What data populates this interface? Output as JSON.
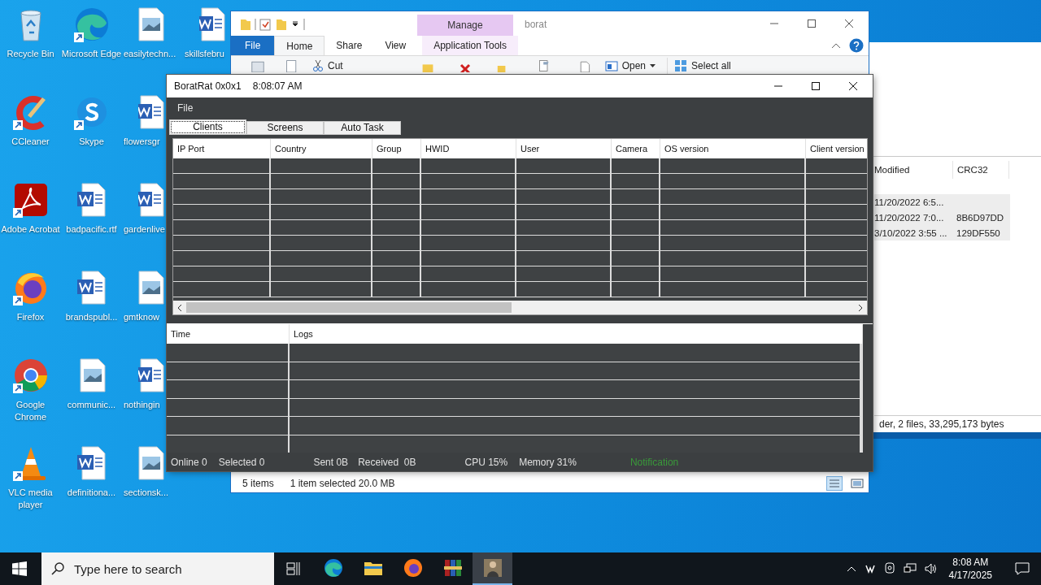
{
  "desktop_icons": [
    {
      "label": "Recycle Bin",
      "kind": "recycle",
      "shortcut": false
    },
    {
      "label": "CCleaner",
      "kind": "ccleaner",
      "shortcut": true
    },
    {
      "label": "Adobe Acrobat",
      "kind": "acrobat",
      "shortcut": true
    },
    {
      "label": "Firefox",
      "kind": "firefox",
      "shortcut": true
    },
    {
      "label": "Google Chrome",
      "kind": "chrome",
      "shortcut": true
    },
    {
      "label": "VLC media player",
      "kind": "vlc",
      "shortcut": true
    },
    {
      "label": "Microsoft Edge",
      "kind": "edge",
      "shortcut": true
    },
    {
      "label": "Skype",
      "kind": "skype",
      "shortcut": true
    },
    {
      "label": "badpacific.rtf",
      "kind": "word",
      "shortcut": false
    },
    {
      "label": "brandspubl...",
      "kind": "word",
      "shortcut": false
    },
    {
      "label": "communic...",
      "kind": "image",
      "shortcut": false
    },
    {
      "label": "definitiona...",
      "kind": "word",
      "shortcut": false
    },
    {
      "label": "easilytechn...",
      "kind": "image",
      "shortcut": false
    },
    {
      "label": "flowersgr",
      "kind": "word",
      "shortcut": false
    },
    {
      "label": "gardenlive",
      "kind": "word",
      "shortcut": false
    },
    {
      "label": "gmtknow",
      "kind": "image",
      "shortcut": false
    },
    {
      "label": "nothingin",
      "kind": "word",
      "shortcut": false
    },
    {
      "label": "sectionsk...",
      "kind": "image",
      "shortcut": false
    },
    {
      "label": "skillsfebru",
      "kind": "word",
      "shortcut": false
    }
  ],
  "explorer": {
    "contextual_group": "Manage",
    "title": "borat",
    "tabs": [
      {
        "label": "File",
        "kind": "backstage",
        "selected": false
      },
      {
        "label": "Home",
        "kind": "normal",
        "selected": true
      },
      {
        "label": "Share",
        "kind": "normal",
        "selected": false
      },
      {
        "label": "View",
        "kind": "normal",
        "selected": false
      },
      {
        "label": "Application Tools",
        "kind": "contextual",
        "selected": false
      }
    ],
    "ribbon_items": [
      {
        "label": "Cut",
        "kind": "cut"
      },
      {
        "label": "Open",
        "kind": "open"
      },
      {
        "label": "Select all",
        "kind": "select-all"
      }
    ],
    "status": [
      "5 items",
      "1 item selected  20.0 MB"
    ]
  },
  "back_window": {
    "columns": [
      "Modified",
      "CRC32"
    ],
    "rows": [
      {
        "modified": "11/20/2022 6:5..."
      },
      {
        "modified": "11/20/2022 7:0...",
        "crc32": "8B6D97DD"
      },
      {
        "modified": "3/10/2022 3:55 ...",
        "crc32": "129DF550"
      }
    ],
    "status": "der, 2 files, 33,295,173 bytes"
  },
  "borat": {
    "title": "BoratRat 0x0x1",
    "time": "8:08:07 AM",
    "menu": [
      "File"
    ],
    "tabs": [
      {
        "label": "Clients",
        "selected": true
      },
      {
        "label": "Screens",
        "selected": false
      },
      {
        "label": "Auto Task",
        "selected": false
      }
    ],
    "client_columns": [
      "IP Port",
      "Country",
      "Group",
      "HWID",
      "User",
      "Camera",
      "OS version",
      "Client version"
    ],
    "log_columns": [
      "Time",
      "Logs"
    ],
    "status_bar": [
      {
        "text": "Online 0",
        "kind": "stat"
      },
      {
        "text": "Selected 0",
        "kind": "stat"
      },
      {
        "text": "Sent 0B",
        "kind": "stat"
      },
      {
        "text": "Received  0B",
        "kind": "stat"
      },
      {
        "text": "CPU 15%",
        "kind": "stat"
      },
      {
        "text": "Memory 31%",
        "kind": "stat"
      },
      {
        "text": "Notification",
        "kind": "notification"
      }
    ]
  },
  "taskbar": {
    "search": {
      "placeholder": "Type here to search"
    },
    "apps": [
      {
        "kind": "edge",
        "selected": false
      },
      {
        "kind": "folder",
        "selected": false
      },
      {
        "kind": "firefox",
        "selected": false
      },
      {
        "kind": "archive",
        "selected": false
      },
      {
        "kind": "rat",
        "selected": true
      }
    ],
    "time": "8:08 AM",
    "date": "4/17/2025"
  }
}
